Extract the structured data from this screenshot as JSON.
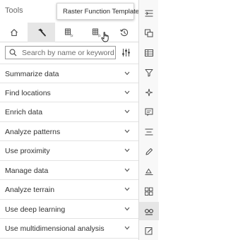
{
  "panel": {
    "title": "Tools",
    "tabs": [
      {
        "name": "home",
        "icon": "home-icon"
      },
      {
        "name": "toolboxes",
        "icon": "hammer-icon",
        "active": true
      },
      {
        "name": "raster-functions",
        "icon": "raster-function-icon"
      },
      {
        "name": "raster-function-templates",
        "icon": "raster-template-icon"
      },
      {
        "name": "history",
        "icon": "history-icon"
      }
    ],
    "tooltip": "Raster Function Templates",
    "search": {
      "placeholder": "Search by name or keyword",
      "value": ""
    },
    "categories": [
      "Summarize data",
      "Find locations",
      "Enrich data",
      "Analyze patterns",
      "Use proximity",
      "Manage data",
      "Analyze terrain",
      "Use deep learning",
      "Use multidimensional analysis"
    ]
  },
  "rail": {
    "icons": [
      "collapse-icon",
      "layers-icon",
      "table-icon",
      "filter-icon",
      "effects-icon",
      "popup-icon",
      "legend-icon",
      "edit-icon",
      "sketch-icon",
      "layers-group-icon",
      "analysis-icon",
      "notes-icon"
    ],
    "active": "analysis-icon"
  },
  "colors": {
    "accent": "#323232",
    "active_bg": "#e6e6e6",
    "border": "#dcdcdc"
  }
}
